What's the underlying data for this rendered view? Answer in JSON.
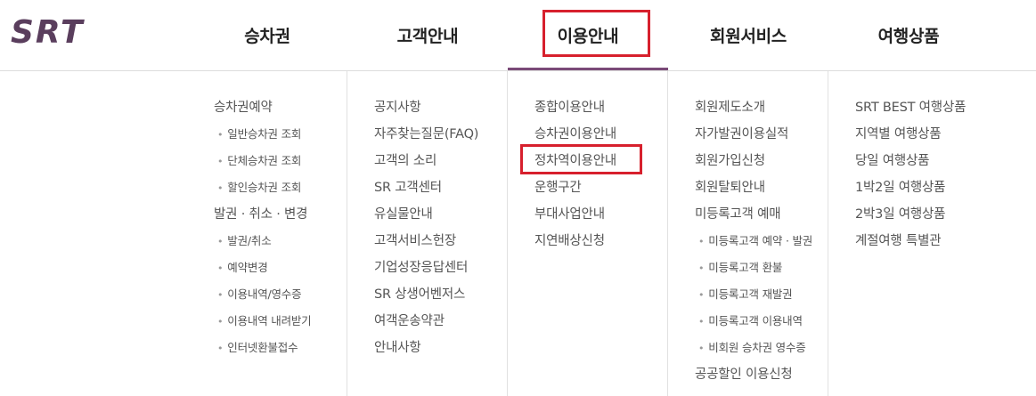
{
  "logo": {
    "text": "SRT",
    "color": "#5a3e5d"
  },
  "nav": {
    "tabs": [
      {
        "label": "승차권"
      },
      {
        "label": "고객안내"
      },
      {
        "label": "이용안내",
        "active": true
      },
      {
        "label": "회원서비스"
      },
      {
        "label": "여행상품"
      }
    ]
  },
  "colors": {
    "accent": "#7a4a78",
    "highlight": "#d7202d"
  },
  "menu": {
    "ticket": [
      {
        "label": "승차권예약",
        "sub": false
      },
      {
        "label": "일반승차권 조회",
        "sub": true
      },
      {
        "label": "단체승차권 조회",
        "sub": true
      },
      {
        "label": "할인승차권 조회",
        "sub": true
      },
      {
        "label": "발권 · 취소 · 변경",
        "sub": false
      },
      {
        "label": "발권/취소",
        "sub": true
      },
      {
        "label": "예약변경",
        "sub": true
      },
      {
        "label": "이용내역/영수증",
        "sub": true
      },
      {
        "label": "이용내역 내려받기",
        "sub": true
      },
      {
        "label": "인터넷환불접수",
        "sub": true
      }
    ],
    "customer": [
      {
        "label": "공지사항"
      },
      {
        "label": "자주찾는질문(FAQ)"
      },
      {
        "label": "고객의 소리"
      },
      {
        "label": "SR 고객센터"
      },
      {
        "label": "유실물안내"
      },
      {
        "label": "고객서비스헌장"
      },
      {
        "label": "기업성장응답센터"
      },
      {
        "label": "SR 상생어벤저스"
      },
      {
        "label": "여객운송약관"
      },
      {
        "label": "안내사항"
      }
    ],
    "usage": [
      {
        "label": "종합이용안내"
      },
      {
        "label": "승차권이용안내"
      },
      {
        "label": "정차역이용안내",
        "highlighted": true
      },
      {
        "label": "운행구간"
      },
      {
        "label": "부대사업안내"
      },
      {
        "label": "지연배상신청"
      }
    ],
    "member": [
      {
        "label": "회원제도소개",
        "sub": false
      },
      {
        "label": "자가발권이용실적",
        "sub": false
      },
      {
        "label": "회원가입신청",
        "sub": false
      },
      {
        "label": "회원탈퇴안내",
        "sub": false
      },
      {
        "label": "미등록고객 예매",
        "sub": false
      },
      {
        "label": "미등록고객 예약 · 발권",
        "sub": true
      },
      {
        "label": "미등록고객 환불",
        "sub": true
      },
      {
        "label": "미등록고객 재발권",
        "sub": true
      },
      {
        "label": "미등록고객 이용내역",
        "sub": true
      },
      {
        "label": "비회원 승차권 영수증",
        "sub": true
      },
      {
        "label": "공공할인 이용신청",
        "sub": false
      }
    ],
    "travel": [
      {
        "label": "SRT BEST 여행상품"
      },
      {
        "label": "지역별 여행상품"
      },
      {
        "label": "당일 여행상품"
      },
      {
        "label": "1박2일 여행상품"
      },
      {
        "label": "2박3일 여행상품"
      },
      {
        "label": "계절여행 특별관"
      }
    ]
  }
}
